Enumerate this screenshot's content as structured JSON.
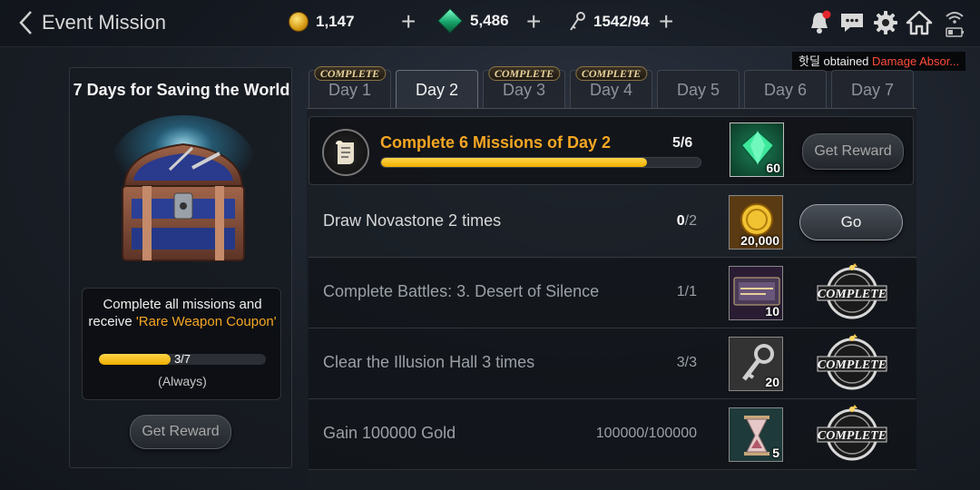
{
  "header": {
    "title": "Event Mission",
    "gold": "1,147",
    "gems": "5,486",
    "keys": "1542/94"
  },
  "notification": {
    "prefix": "핫딜 obtained ",
    "highlight": "Damage Absor..."
  },
  "left_panel": {
    "title": "7 Days for Saving the World",
    "desc_line1": "Complete all missions and",
    "desc_line2_prefix": "receive ",
    "desc_line2_highlight": "'Rare Weapon Coupon'",
    "progress_text": "3/7",
    "progress_fraction": 0.43,
    "progress_note": "(Always)",
    "button_label": "Get Reward"
  },
  "tabs": [
    {
      "label": "Day 1",
      "badge": "COMPLETE"
    },
    {
      "label": "Day 2",
      "badge": ""
    },
    {
      "label": "Day 3",
      "badge": "COMPLETE"
    },
    {
      "label": "Day 4",
      "badge": "COMPLETE"
    },
    {
      "label": "Day 5",
      "badge": ""
    },
    {
      "label": "Day 6",
      "badge": ""
    },
    {
      "label": "Day 7",
      "badge": ""
    }
  ],
  "active_tab": "Day 2",
  "summary": {
    "title": "Complete 6 Missions of Day 2",
    "progress": "5/6",
    "progress_fraction": 0.833,
    "reward_qty": "60",
    "button_label": "Get Reward"
  },
  "missions": [
    {
      "name": "Draw Novastone 2 times",
      "current": "0",
      "total": "/2",
      "reward_qty": "20,000",
      "action": "Go",
      "done": false
    },
    {
      "name": "Complete Battles: 3. Desert of Silence",
      "current": "",
      "total": "1/1",
      "reward_qty": "10",
      "action": "COMPLETE",
      "done": true
    },
    {
      "name": "Clear the Illusion Hall 3 times",
      "current": "",
      "total": "3/3",
      "reward_qty": "20",
      "action": "COMPLETE",
      "done": true
    },
    {
      "name": "Gain 100000 Gold",
      "current": "",
      "total": "100000/100000",
      "reward_qty": "5",
      "action": "COMPLETE",
      "done": true
    }
  ],
  "colors": {
    "accent_orange": "#f5a623",
    "progress_yellow": "#ffc61a",
    "toast_highlight": "#ff4c3a"
  }
}
